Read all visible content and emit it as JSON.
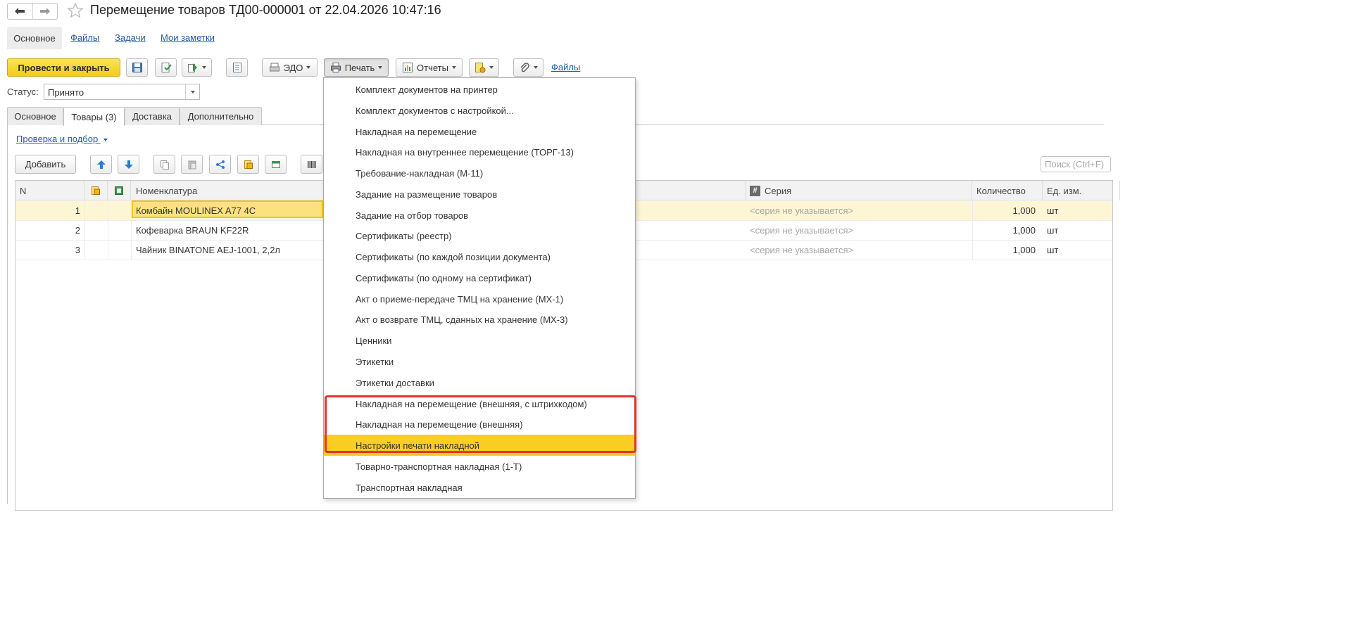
{
  "window": {
    "title": "Перемещение товаров ТД00-000001 от 22.04.2026 10:47:16"
  },
  "section_tabs": {
    "main": "Основное",
    "files": "Файлы",
    "tasks": "Задачи",
    "notes": "Мои заметки"
  },
  "toolbar": {
    "post_close": "Провести и закрыть",
    "edo": "ЭДО",
    "print": "Печать",
    "reports": "Отчеты",
    "files_link": "Файлы"
  },
  "status": {
    "label": "Статус:",
    "value": "Принято"
  },
  "page_tabs": [
    "Основное",
    "Товары (3)",
    "Доставка",
    "Дополнительно"
  ],
  "goods": {
    "check_link": "Проверка и подбор",
    "add_button": "Добавить",
    "search_placeholder": "Поиск (Ctrl+F)",
    "columns": {
      "n": "N",
      "nomenclature": "Номенклатура",
      "series": "Серия",
      "quantity": "Количество",
      "unit": "Ед. изм."
    },
    "rows": [
      {
        "n": "1",
        "name": "Комбайн MOULINEX  A77 4C",
        "series": "<серия не указывается>",
        "qty": "1,000",
        "unit": "шт"
      },
      {
        "n": "2",
        "name": "Кофеварка BRAUN KF22R",
        "series": "<серия не указывается>",
        "qty": "1,000",
        "unit": "шт"
      },
      {
        "n": "3",
        "name": "Чайник BINATONE  AEJ-1001,  2,2л",
        "series": "<серия не указывается>",
        "qty": "1,000",
        "unit": "шт"
      }
    ]
  },
  "print_menu": {
    "items": [
      "Комплект документов на принтер",
      "Комплект документов с настройкой...",
      "Накладная на перемещение",
      "Накладная на внутреннее перемещение (ТОРГ-13)",
      "Требование-накладная (М-11)",
      "Задание на размещение товаров",
      "Задание на отбор товаров",
      "Сертификаты (реестр)",
      "Сертификаты (по каждой позиции документа)",
      "Сертификаты (по одному на сертификат)",
      "Акт о приеме-передаче ТМЦ на хранение (МХ-1)",
      "Акт о возврате ТМЦ, сданных на хранение (МХ-3)",
      "Ценники",
      "Этикетки",
      "Этикетки доставки",
      "Накладная на перемещение (внешняя, с штрихкодом)",
      "Накладная на перемещение (внешняя)",
      "Настройки печати накладной",
      "Товарно-транспортная накладная (1-Т)",
      "Транспортная накладная"
    ],
    "highlighted_item": "Настройки печати накладной"
  },
  "colors": {
    "accent_yellow": "#f3cd12",
    "menu_highlight": "#f9cd22",
    "annotation_red": "#e4332b",
    "link_blue": "#2359a8",
    "selected_row": "#fdf6d4"
  }
}
